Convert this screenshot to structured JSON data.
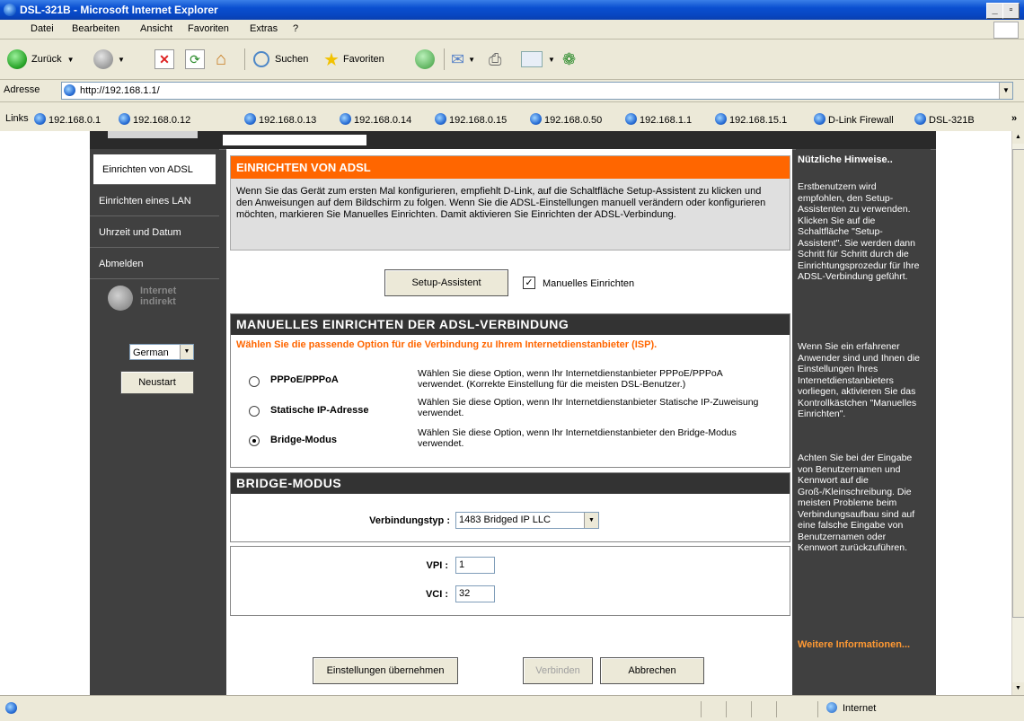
{
  "window": {
    "title": "DSL-321B - Microsoft Internet Explorer"
  },
  "menu": {
    "items": [
      "Datei",
      "Bearbeiten",
      "Ansicht",
      "Favoriten",
      "Extras",
      "?"
    ]
  },
  "toolbar": {
    "back": "Zurück",
    "search": "Suchen",
    "favorites": "Favoriten"
  },
  "address": {
    "label": "Adresse",
    "url": "http://192.168.1.1/"
  },
  "links": {
    "label": "Links",
    "items": [
      "192.168.0.1",
      "192.168.0.12",
      "192.168.0.13",
      "192.168.0.14",
      "192.168.0.15",
      "192.168.0.50",
      "192.168.1.1",
      "192.168.15.1",
      "D-Link Firewall",
      "DSL-321B"
    ]
  },
  "nav": {
    "items": [
      "Einrichten von ADSL",
      "Einrichten eines LAN",
      "Uhrzeit und Datum",
      "Abmelden"
    ],
    "internet_status": "Internet indirekt",
    "language": "German",
    "restart": "Neustart"
  },
  "setup": {
    "title": "EINRICHTEN VON ADSL",
    "description": "Wenn Sie das Gerät zum ersten Mal konfigurieren, empfiehlt D-Link, auf die Schaltfläche Setup-Assistent zu klicken und den Anweisungen auf dem Bildschirm zu folgen. Wenn Sie die ADSL-Einstellungen manuell verändern oder konfigurieren möchten, markieren Sie Manuelles Einrichten. Damit aktivieren Sie Einrichten der ADSL-Verbindung.",
    "wizard_button": "Setup-Assistent",
    "manual_label": "Manuelles Einrichten"
  },
  "manual": {
    "title": "MANUELLES EINRICHTEN DER ADSL-VERBINDUNG",
    "subtitle": "Wählen Sie die passende Option für die Verbindung zu Ihrem Internetdienstanbieter (ISP).",
    "options": [
      {
        "label": "PPPoE/PPPoA",
        "desc": "Wählen Sie diese Option, wenn Ihr Internetdienstanbieter PPPoE/PPPoA verwendet. (Korrekte Einstellung für die meisten DSL-Benutzer.)"
      },
      {
        "label": "Statische IP-Adresse",
        "desc": "Wählen Sie diese Option, wenn Ihr Internetdienstanbieter Statische IP-Zuweisung verwendet."
      },
      {
        "label": "Bridge-Modus",
        "desc": "Wählen Sie diese Option, wenn Ihr Internetdienstanbieter den Bridge-Modus verwendet."
      }
    ]
  },
  "bridge": {
    "title": "BRIDGE-MODUS",
    "type_label": "Verbindungstyp :",
    "type_value": "1483 Bridged IP LLC",
    "vpi_label": "VPI :",
    "vpi_value": "1",
    "vci_label": "VCI :",
    "vci_value": "32"
  },
  "actions": {
    "apply": "Einstellungen übernehmen",
    "connect": "Verbinden",
    "cancel": "Abbrechen"
  },
  "hints": {
    "title": "Nützliche Hinweise..",
    "p1": "Erstbenutzern wird empfohlen, den Setup-Assistenten zu verwenden. Klicken Sie auf die Schaltfläche \"Setup-Assistent\". Sie werden dann Schritt für Schritt durch die Einrichtungsprozedur für Ihre ADSL-Verbindung geführt.",
    "p2": "Wenn Sie ein erfahrener Anwender sind und Ihnen die Einstellungen Ihres Internetdienstanbieters vorliegen, aktivieren Sie das Kontrollkästchen \"Manuelles Einrichten\".",
    "p3": "Achten Sie bei der Eingabe von Benutzernamen und Kennwort auf die Groß-/Kleinschreibung. Die meisten Probleme beim Verbindungsaufbau sind auf eine falsche Eingabe von Benutzernamen oder Kennwort zurückzuführen.",
    "more": "Weitere Informationen..."
  },
  "status": {
    "zone": "Internet"
  }
}
